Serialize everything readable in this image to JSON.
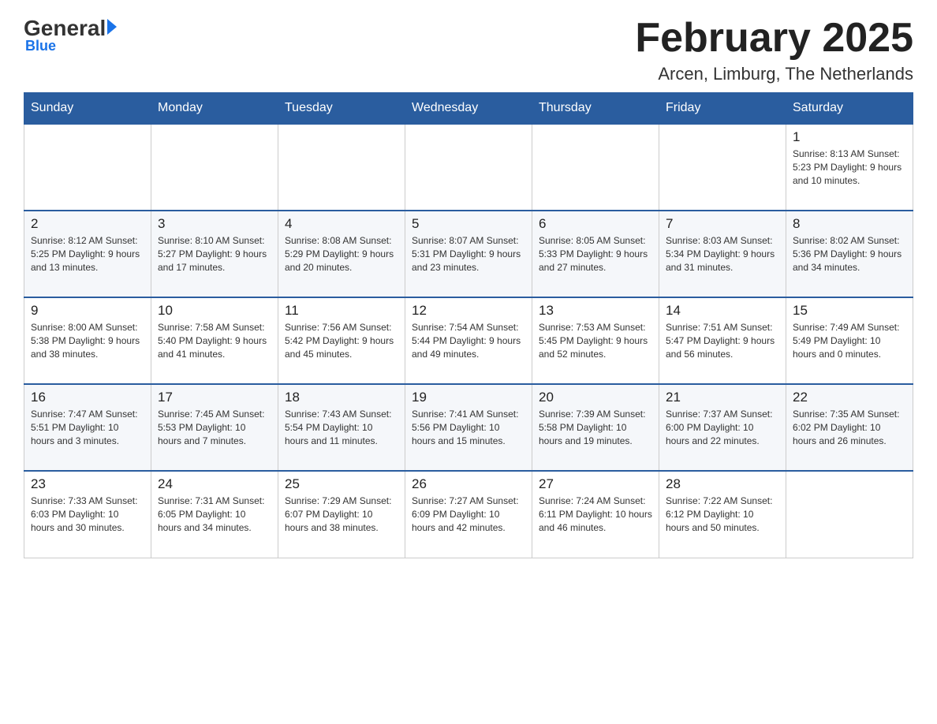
{
  "header": {
    "logo_general": "General",
    "logo_blue": "Blue",
    "month_title": "February 2025",
    "subtitle": "Arcen, Limburg, The Netherlands"
  },
  "days_of_week": [
    "Sunday",
    "Monday",
    "Tuesday",
    "Wednesday",
    "Thursday",
    "Friday",
    "Saturday"
  ],
  "weeks": [
    [
      {
        "day": "",
        "info": ""
      },
      {
        "day": "",
        "info": ""
      },
      {
        "day": "",
        "info": ""
      },
      {
        "day": "",
        "info": ""
      },
      {
        "day": "",
        "info": ""
      },
      {
        "day": "",
        "info": ""
      },
      {
        "day": "1",
        "info": "Sunrise: 8:13 AM\nSunset: 5:23 PM\nDaylight: 9 hours and 10 minutes."
      }
    ],
    [
      {
        "day": "2",
        "info": "Sunrise: 8:12 AM\nSunset: 5:25 PM\nDaylight: 9 hours and 13 minutes."
      },
      {
        "day": "3",
        "info": "Sunrise: 8:10 AM\nSunset: 5:27 PM\nDaylight: 9 hours and 17 minutes."
      },
      {
        "day": "4",
        "info": "Sunrise: 8:08 AM\nSunset: 5:29 PM\nDaylight: 9 hours and 20 minutes."
      },
      {
        "day": "5",
        "info": "Sunrise: 8:07 AM\nSunset: 5:31 PM\nDaylight: 9 hours and 23 minutes."
      },
      {
        "day": "6",
        "info": "Sunrise: 8:05 AM\nSunset: 5:33 PM\nDaylight: 9 hours and 27 minutes."
      },
      {
        "day": "7",
        "info": "Sunrise: 8:03 AM\nSunset: 5:34 PM\nDaylight: 9 hours and 31 minutes."
      },
      {
        "day": "8",
        "info": "Sunrise: 8:02 AM\nSunset: 5:36 PM\nDaylight: 9 hours and 34 minutes."
      }
    ],
    [
      {
        "day": "9",
        "info": "Sunrise: 8:00 AM\nSunset: 5:38 PM\nDaylight: 9 hours and 38 minutes."
      },
      {
        "day": "10",
        "info": "Sunrise: 7:58 AM\nSunset: 5:40 PM\nDaylight: 9 hours and 41 minutes."
      },
      {
        "day": "11",
        "info": "Sunrise: 7:56 AM\nSunset: 5:42 PM\nDaylight: 9 hours and 45 minutes."
      },
      {
        "day": "12",
        "info": "Sunrise: 7:54 AM\nSunset: 5:44 PM\nDaylight: 9 hours and 49 minutes."
      },
      {
        "day": "13",
        "info": "Sunrise: 7:53 AM\nSunset: 5:45 PM\nDaylight: 9 hours and 52 minutes."
      },
      {
        "day": "14",
        "info": "Sunrise: 7:51 AM\nSunset: 5:47 PM\nDaylight: 9 hours and 56 minutes."
      },
      {
        "day": "15",
        "info": "Sunrise: 7:49 AM\nSunset: 5:49 PM\nDaylight: 10 hours and 0 minutes."
      }
    ],
    [
      {
        "day": "16",
        "info": "Sunrise: 7:47 AM\nSunset: 5:51 PM\nDaylight: 10 hours and 3 minutes."
      },
      {
        "day": "17",
        "info": "Sunrise: 7:45 AM\nSunset: 5:53 PM\nDaylight: 10 hours and 7 minutes."
      },
      {
        "day": "18",
        "info": "Sunrise: 7:43 AM\nSunset: 5:54 PM\nDaylight: 10 hours and 11 minutes."
      },
      {
        "day": "19",
        "info": "Sunrise: 7:41 AM\nSunset: 5:56 PM\nDaylight: 10 hours and 15 minutes."
      },
      {
        "day": "20",
        "info": "Sunrise: 7:39 AM\nSunset: 5:58 PM\nDaylight: 10 hours and 19 minutes."
      },
      {
        "day": "21",
        "info": "Sunrise: 7:37 AM\nSunset: 6:00 PM\nDaylight: 10 hours and 22 minutes."
      },
      {
        "day": "22",
        "info": "Sunrise: 7:35 AM\nSunset: 6:02 PM\nDaylight: 10 hours and 26 minutes."
      }
    ],
    [
      {
        "day": "23",
        "info": "Sunrise: 7:33 AM\nSunset: 6:03 PM\nDaylight: 10 hours and 30 minutes."
      },
      {
        "day": "24",
        "info": "Sunrise: 7:31 AM\nSunset: 6:05 PM\nDaylight: 10 hours and 34 minutes."
      },
      {
        "day": "25",
        "info": "Sunrise: 7:29 AM\nSunset: 6:07 PM\nDaylight: 10 hours and 38 minutes."
      },
      {
        "day": "26",
        "info": "Sunrise: 7:27 AM\nSunset: 6:09 PM\nDaylight: 10 hours and 42 minutes."
      },
      {
        "day": "27",
        "info": "Sunrise: 7:24 AM\nSunset: 6:11 PM\nDaylight: 10 hours and 46 minutes."
      },
      {
        "day": "28",
        "info": "Sunrise: 7:22 AM\nSunset: 6:12 PM\nDaylight: 10 hours and 50 minutes."
      },
      {
        "day": "",
        "info": ""
      }
    ]
  ]
}
